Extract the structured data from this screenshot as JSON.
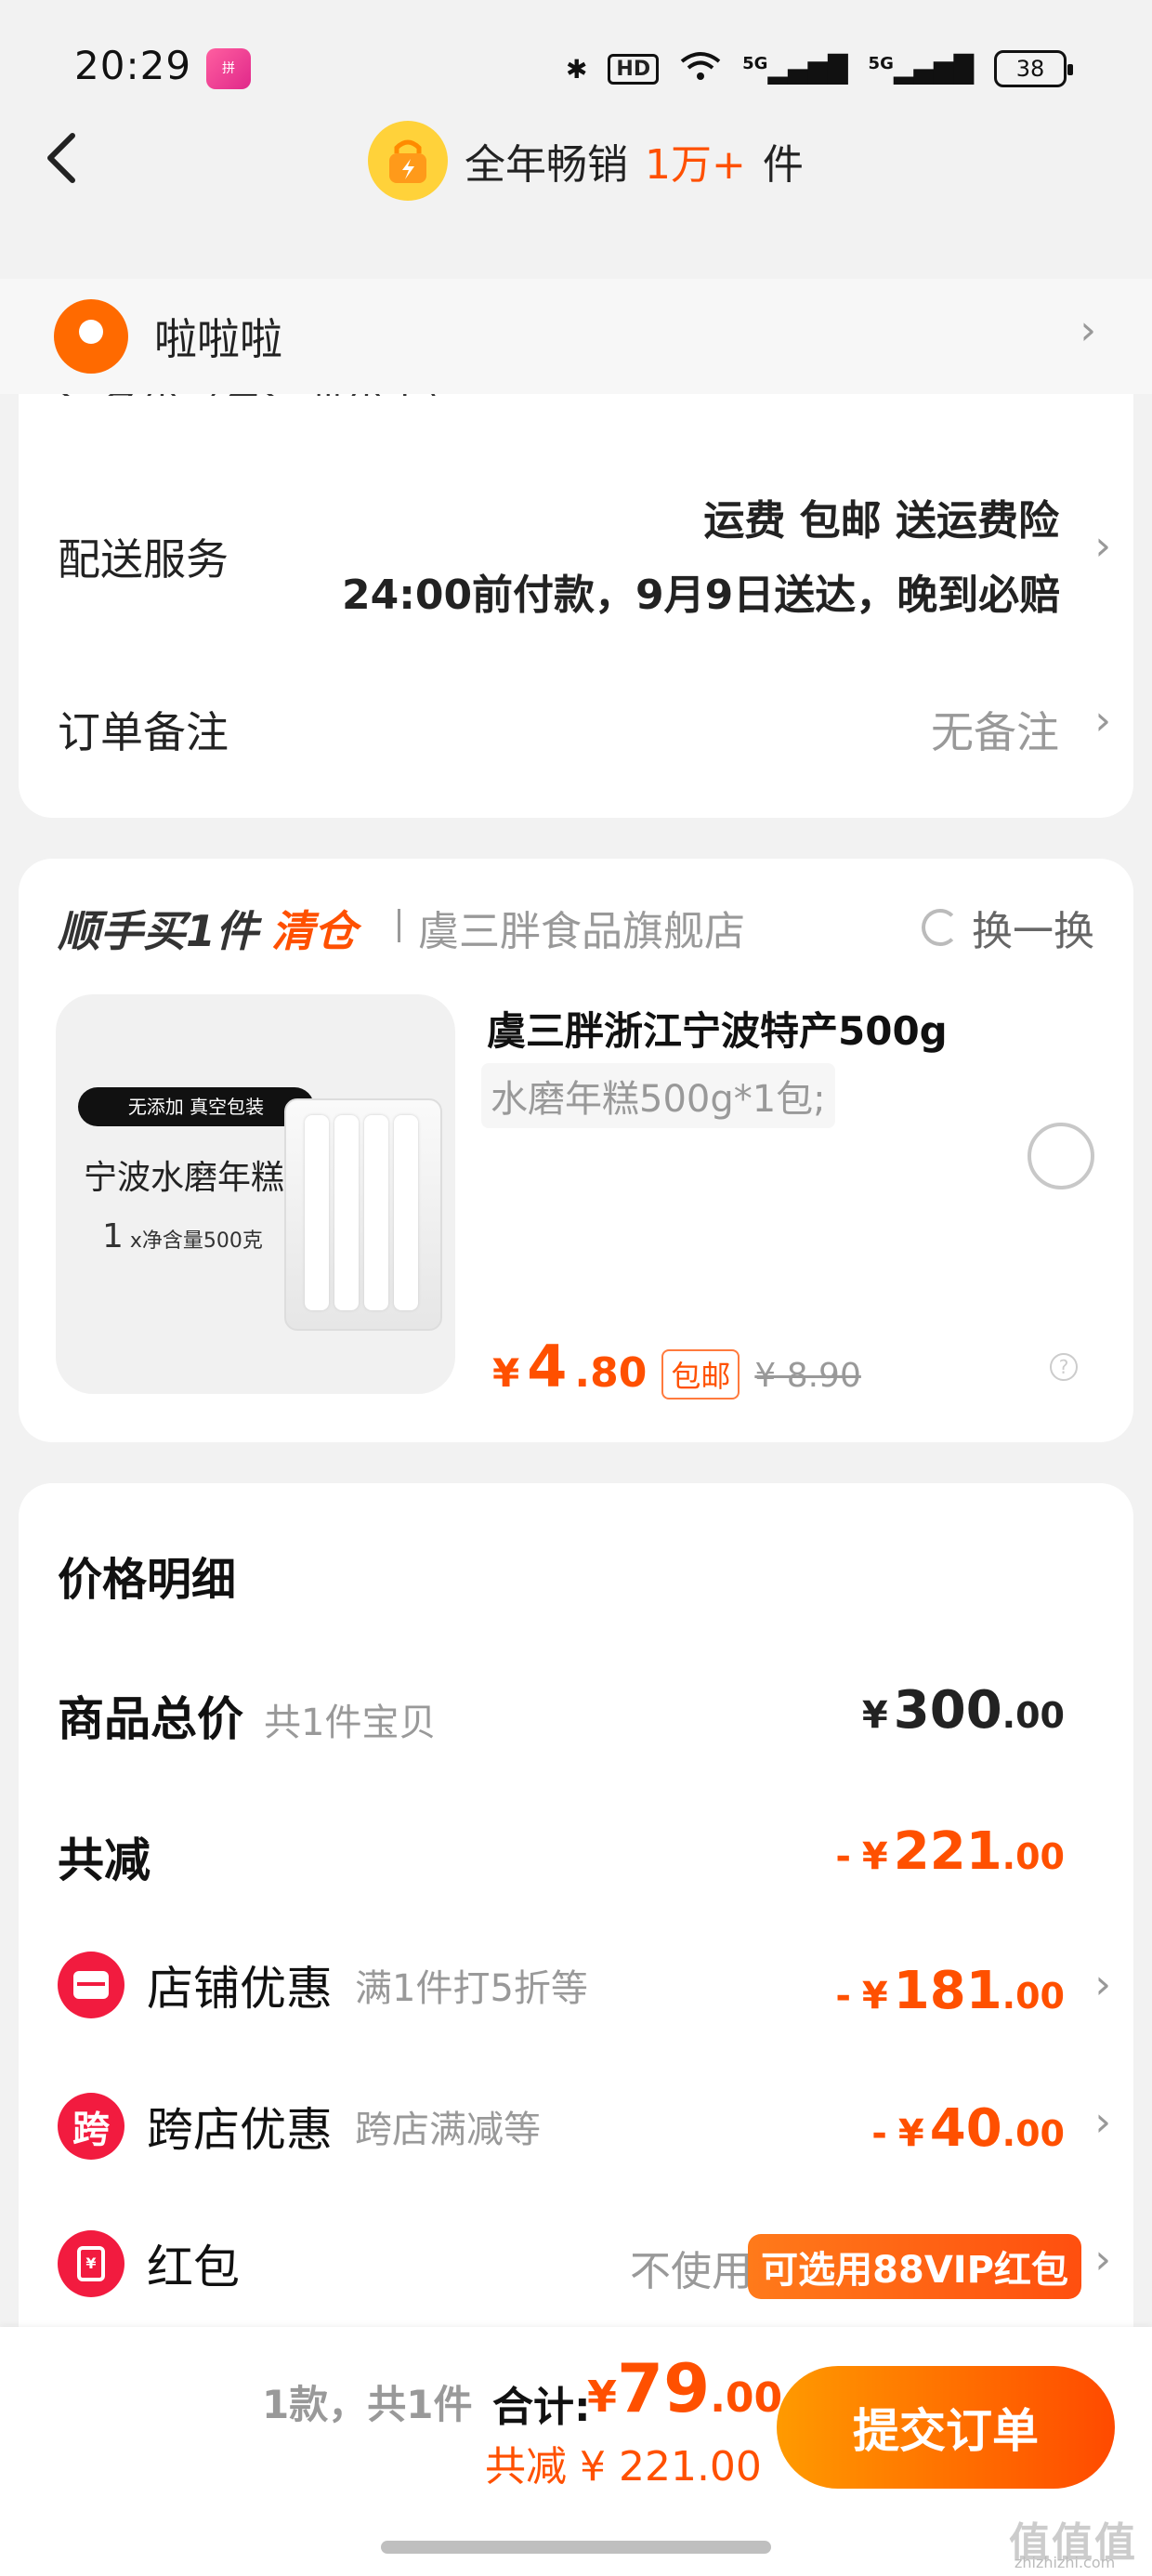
{
  "status_bar": {
    "time": "20:29",
    "app_badge": "拼",
    "hd": "HD",
    "signal1": "5G",
    "signal2": "5G",
    "battery": "38"
  },
  "nav": {
    "title_prefix": "全年畅销",
    "title_highlight": "1万+",
    "title_suffix": "件"
  },
  "address": {
    "name": "啦啦啦"
  },
  "shipping": {
    "clipped_text": "运名优（包运费优惠）",
    "service_label": "配送服务",
    "service_line1": "运费 包邮 送运费险",
    "service_line2": "24:00前付款，9月9日送达，晚到必赔",
    "note_label": "订单备注",
    "note_value": "无备注"
  },
  "addon": {
    "head": "顺手买1件",
    "tag": "清仓",
    "store": "虞三胖食品旗舰店",
    "swap": "换一换",
    "product": {
      "image_tag": "无添加 真空包装",
      "image_name": "宁波水磨年糕",
      "image_qty": "1",
      "image_weight": "x净含量500克",
      "title": "虞三胖浙江宁波特产500g",
      "spec": "水磨年糕500g*1包;",
      "price_currency": "¥",
      "price_int": "4",
      "price_dec": ".80",
      "badge": "包邮",
      "orig_price": "¥ 8.90",
      "help": "?"
    }
  },
  "price_detail": {
    "title": "价格明细",
    "goods_total": {
      "label": "商品总价",
      "sub": "共1件宝贝",
      "cur": "¥",
      "int": "300",
      "dec": ".00"
    },
    "discount_total": {
      "label": "共减",
      "minus": "-",
      "cur": "¥",
      "int": "221",
      "dec": ".00"
    },
    "shop_discount": {
      "label": "店铺优惠",
      "sub": "满1件打5折等",
      "minus": "-",
      "cur": "¥",
      "int": "181",
      "dec": ".00"
    },
    "cross_discount": {
      "label": "跨店优惠",
      "icon_text": "跨",
      "sub": "跨店满减等",
      "minus": "-",
      "cur": "¥",
      "int": "40",
      "dec": ".00"
    },
    "red_packet": {
      "label": "红包",
      "icon_text": "¥",
      "not_use": "不使用",
      "vip": "可选用88VIP红包"
    }
  },
  "bottom": {
    "count": "1款，共1件",
    "total_label": "合计:",
    "total_cur": "¥",
    "total_int": "79",
    "total_dec": ".00",
    "saved": "共减 ¥ 221.00",
    "submit": "提交订单"
  },
  "watermark": {
    "main": "值值值",
    "sub": "zhizhizhi.com"
  },
  "colors": {
    "accent": "#ff5000",
    "red_icon": "#f21b3f",
    "button_start": "#ff9a00",
    "button_end": "#ff4a00"
  }
}
